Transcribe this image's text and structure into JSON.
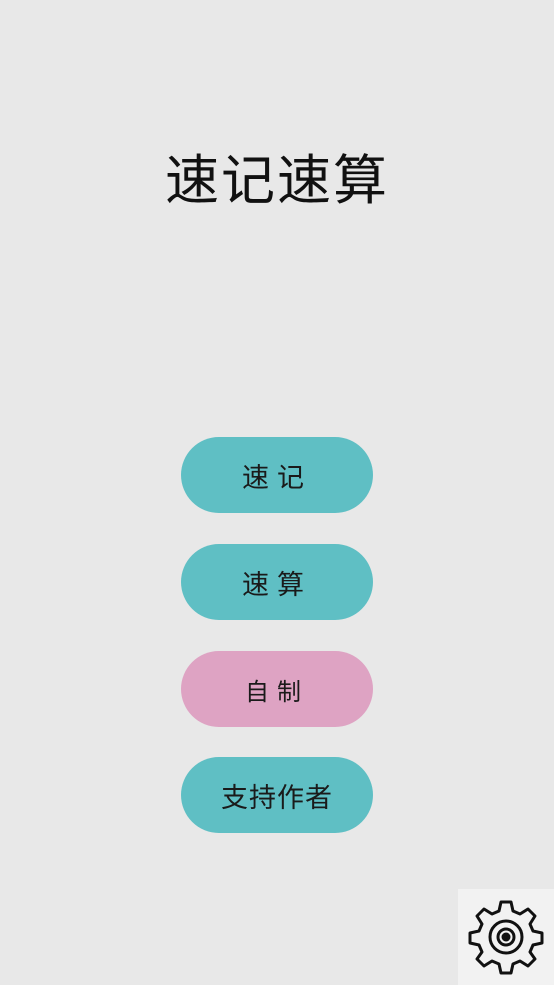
{
  "app": {
    "title": "速记速算"
  },
  "menu": {
    "memory_label": "速记",
    "calculation_label": "速算",
    "custom_label": "自制",
    "support_label": "支持作者"
  },
  "colors": {
    "background": "#e8e8e8",
    "primary_button": "#5fbfc4",
    "custom_button": "#dea3c3",
    "settings_button_bg": "#f2f2f2"
  },
  "icons": {
    "settings": "gear-icon"
  }
}
